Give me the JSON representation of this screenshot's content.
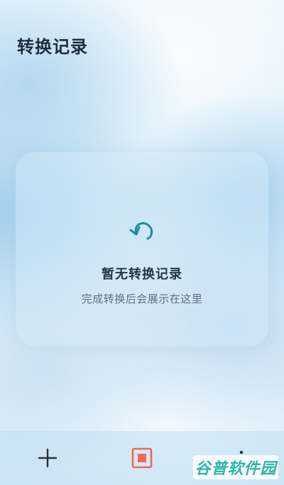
{
  "header": {
    "title": "转换记录"
  },
  "empty_state": {
    "icon": "undo-arrow-icon",
    "title": "暂无转换记录",
    "subtitle": "完成转换后会展示在这里"
  },
  "bottom_nav": {
    "items": [
      {
        "icon": "plus-icon"
      },
      {
        "icon": "record-icon",
        "color": "#f06a55"
      },
      {
        "icon": "more-icon"
      }
    ]
  },
  "watermark": {
    "text": "谷普软件园"
  },
  "colors": {
    "accent_teal": "#1e8a9a",
    "record_red": "#f06a55",
    "title_text": "#1e2e40"
  }
}
